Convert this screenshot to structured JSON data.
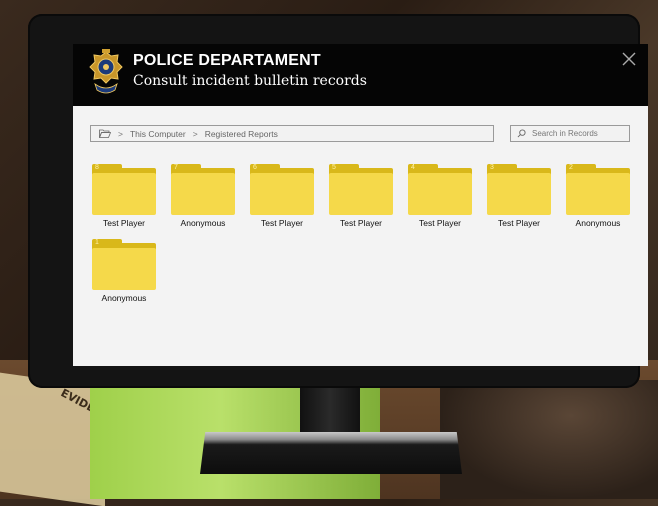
{
  "app": {
    "title": "POLICE DEPARTAMENT",
    "subtitle": "Consult incident bulletin records"
  },
  "breadcrumb": {
    "items": [
      "This Computer",
      "Registered Reports"
    ],
    "separator": ">"
  },
  "search": {
    "placeholder": "Search in Records"
  },
  "folders": [
    {
      "number": "8",
      "label": "Test Player"
    },
    {
      "number": "7",
      "label": "Anonymous"
    },
    {
      "number": "6",
      "label": "Test Player"
    },
    {
      "number": "5",
      "label": "Test Player"
    },
    {
      "number": "4",
      "label": "Test Player"
    },
    {
      "number": "3",
      "label": "Test Player"
    },
    {
      "number": "2",
      "label": "Anonymous"
    },
    {
      "number": "1",
      "label": "Anonymous"
    }
  ],
  "scene": {
    "paper_text": "EVIDENCE"
  },
  "colors": {
    "folder_front": "#f5d94a",
    "folder_back": "#d9b81a",
    "titlebar": "#050505"
  },
  "icons": {
    "close": "close-icon",
    "search": "search-icon",
    "breadcrumb": "folder-open-icon",
    "badge": "police-badge-icon"
  }
}
